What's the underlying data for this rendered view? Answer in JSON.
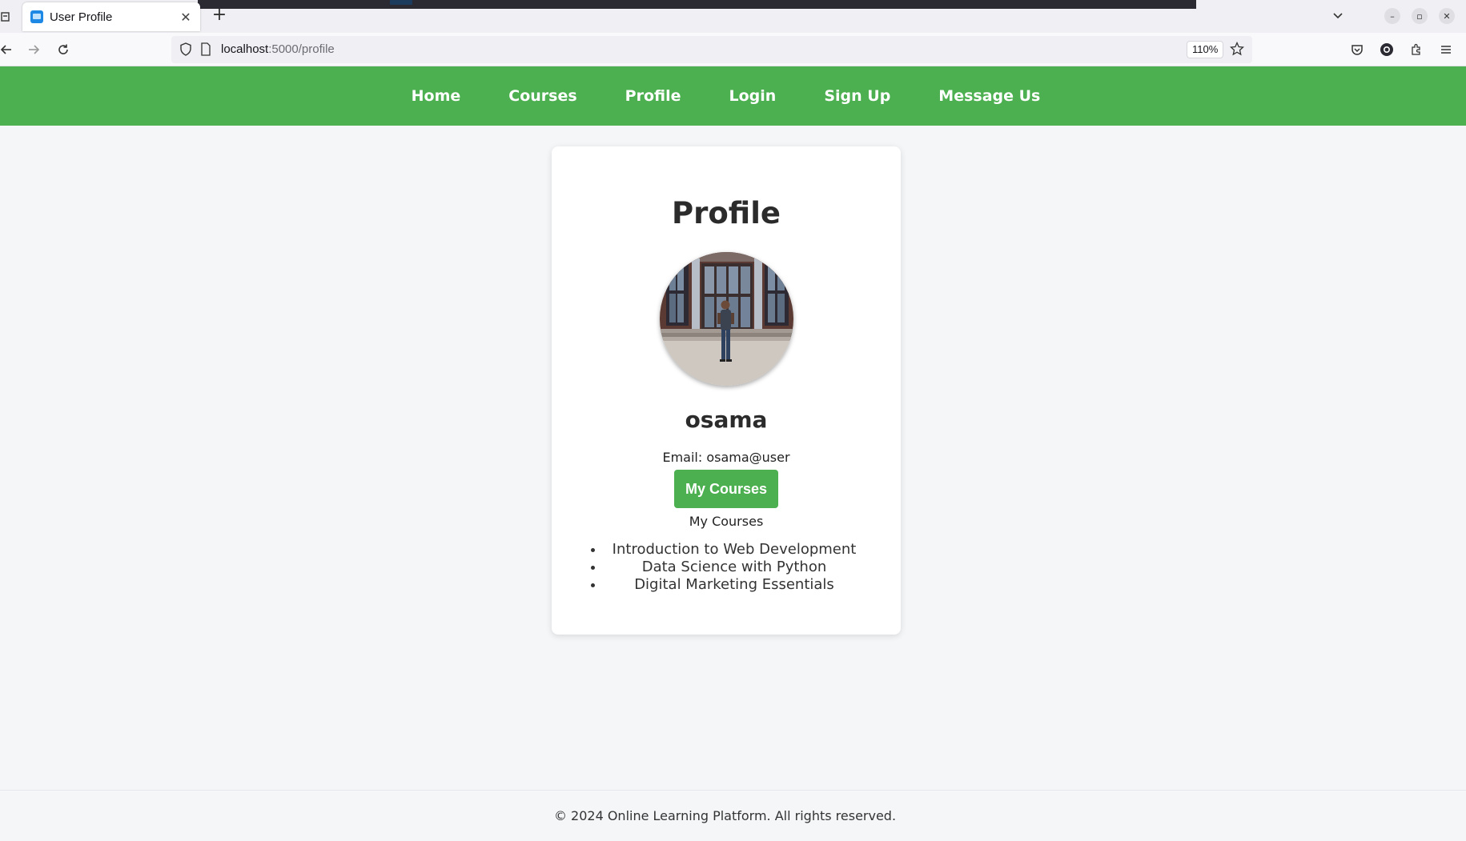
{
  "browser": {
    "tab_title": "User Profile",
    "url_host": "localhost",
    "url_path": ":5000/profile",
    "zoom": "110%"
  },
  "nav": {
    "items": [
      "Home",
      "Courses",
      "Profile",
      "Login",
      "Sign Up",
      "Message Us"
    ]
  },
  "profile": {
    "heading": "Profile",
    "username": "osama",
    "email_text": "Email: osama@user",
    "button_label": "My Courses",
    "courses_label": "My Courses",
    "courses": [
      "Introduction to Web Development",
      "Data Science with Python",
      "Digital Marketing Essentials"
    ]
  },
  "footer": {
    "text": "© 2024 Online Learning Platform. All rights reserved."
  },
  "colors": {
    "accent": "#4caf50",
    "background": "#f4f6f8"
  }
}
